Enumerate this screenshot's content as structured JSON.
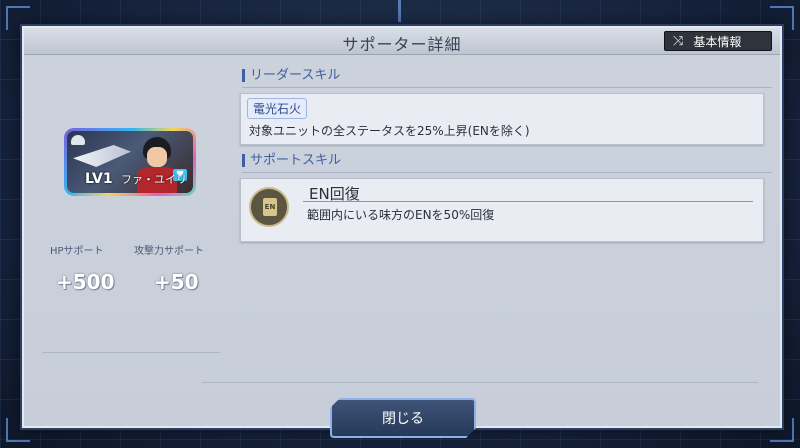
{
  "dialog": {
    "title": "サポーター詳細",
    "basic_info_label": "基本情報",
    "basic_info_icon": "shuffle-icon",
    "close_label": "閉じる"
  },
  "card": {
    "level": "LV1",
    "name": "ファ・ユイリ"
  },
  "stats": [
    {
      "label": "HPサポート",
      "value": "+500"
    },
    {
      "label": "攻撃力サポート",
      "value": "+50"
    }
  ],
  "leader_skill": {
    "section_title": "リーダースキル",
    "name": "電光石火",
    "description": "対象ユニットの全ステータスを25%上昇(ENを除く)"
  },
  "support_skill": {
    "section_title": "サポートスキル",
    "icon": "en-battery-icon",
    "icon_text": "EN",
    "name": "EN回復",
    "description": "範囲内にいる味方のENを50%回復"
  },
  "colors": {
    "accent": "#3f5fa0",
    "panel": "#cdd3dd",
    "button": "#26395a"
  }
}
